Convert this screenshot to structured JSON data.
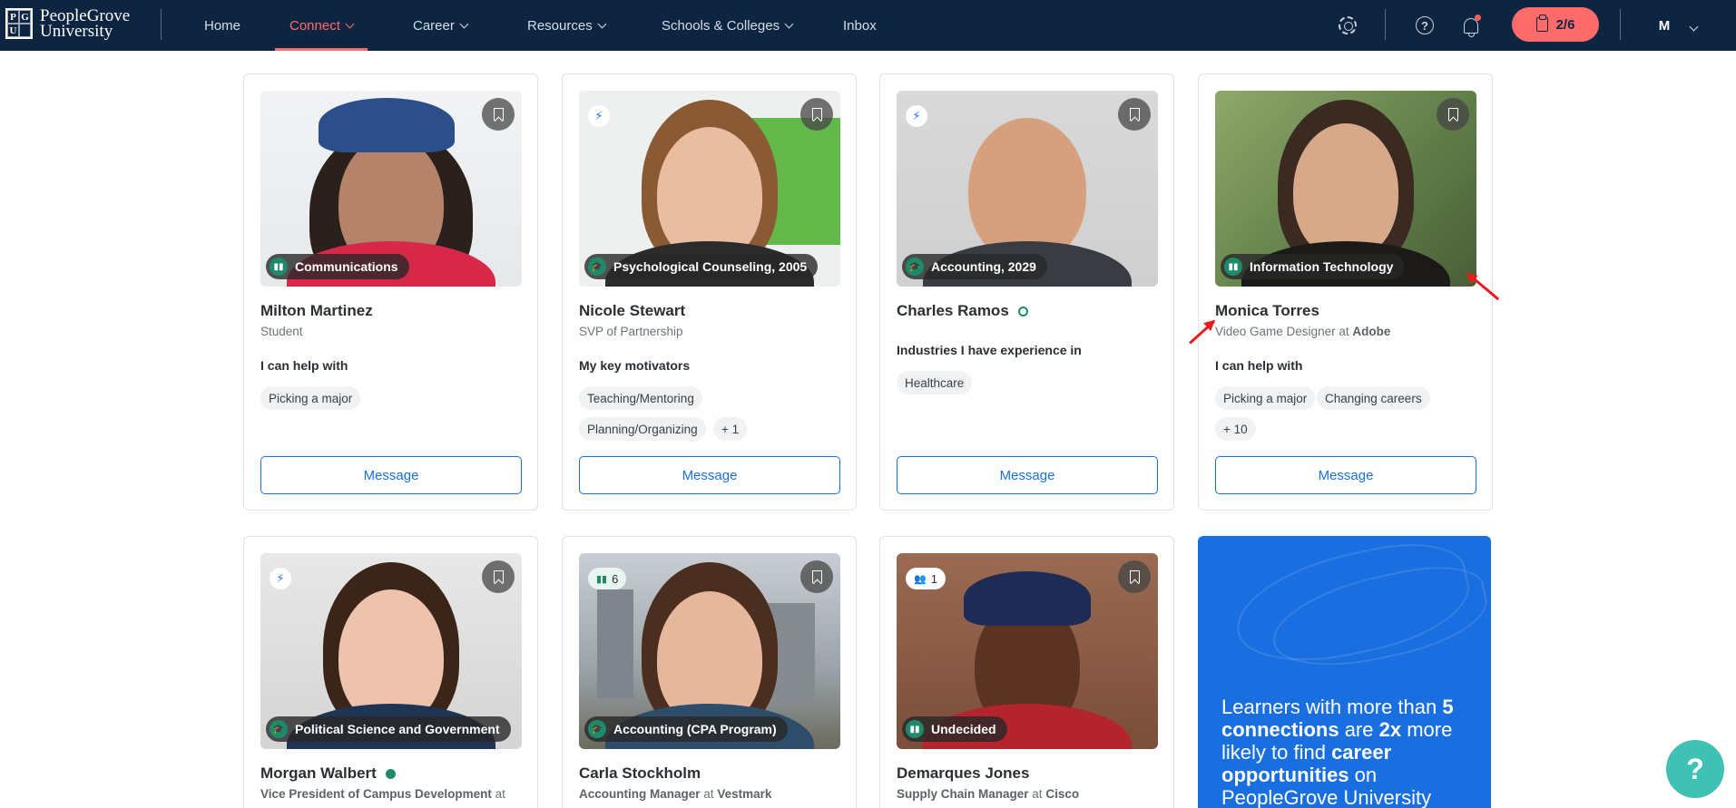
{
  "brand": {
    "line1": "PeopleGrove",
    "line2": "University",
    "mark": [
      "P",
      "G",
      "U",
      ""
    ]
  },
  "nav": {
    "items": [
      {
        "label": "Home"
      },
      {
        "label": "Connect"
      },
      {
        "label": "Career"
      },
      {
        "label": "Resources"
      },
      {
        "label": "Schools & Colleges"
      },
      {
        "label": "Inbox"
      }
    ],
    "progress": "2/6",
    "avatar_initial": "M"
  },
  "cards": [
    {
      "name": "Milton Martinez",
      "role": "Student",
      "tag": "Communications",
      "section": "I can help with",
      "chips": [
        "Picking a major"
      ],
      "button": "Message"
    },
    {
      "name": "Nicole Stewart",
      "role": "SVP of Partnership",
      "tag": "Psychological Counseling, 2005",
      "section": "My key motivators",
      "chips": [
        "Teaching/Mentoring",
        "Planning/Organizing",
        "+ 1"
      ],
      "button": "Message"
    },
    {
      "name": "Charles Ramos",
      "role": "",
      "tag": "Accounting, 2029",
      "section": "Industries I have experience in",
      "chips": [
        "Healthcare"
      ],
      "button": "Message"
    },
    {
      "name": "Monica Torres",
      "role_title": "Video Game Designer",
      "role_at": "at",
      "role_company": "Adobe",
      "tag": "Information Technology",
      "section": "I can help with",
      "chips": [
        "Picking a major",
        "Changing careers",
        "+ 10"
      ],
      "button": "Message"
    },
    {
      "name": "Morgan Walbert",
      "role_title": "Vice President of Campus Development",
      "role_at": "at",
      "tag": "Political Science and Government"
    },
    {
      "name": "Carla Stockholm",
      "role_title": "Accounting Manager",
      "role_at": "at",
      "role_company": "Vestmark",
      "tag": "Accounting (CPA Program)",
      "badge_count": "6"
    },
    {
      "name": "Demarques Jones",
      "role_title": "Supply Chain Manager",
      "role_at": "at",
      "role_company": "Cisco",
      "tag": "Undecided",
      "badge_count": "1"
    }
  ],
  "promo": {
    "p1": "Learners with more than ",
    "b1": "5 connections",
    "p2": " are ",
    "b2": "2x",
    "p3": " more likely to find ",
    "b3": "career opportunities",
    "p4": " on PeopleGrove University"
  },
  "help_fab": "?",
  "colors": {
    "nav_bg": "#0d2541",
    "accent": "#ff6b6b",
    "primary": "#1a6fd8",
    "promo": "#1a6fe0",
    "online": "#1f8a6a",
    "fab": "#3fc1b4"
  }
}
